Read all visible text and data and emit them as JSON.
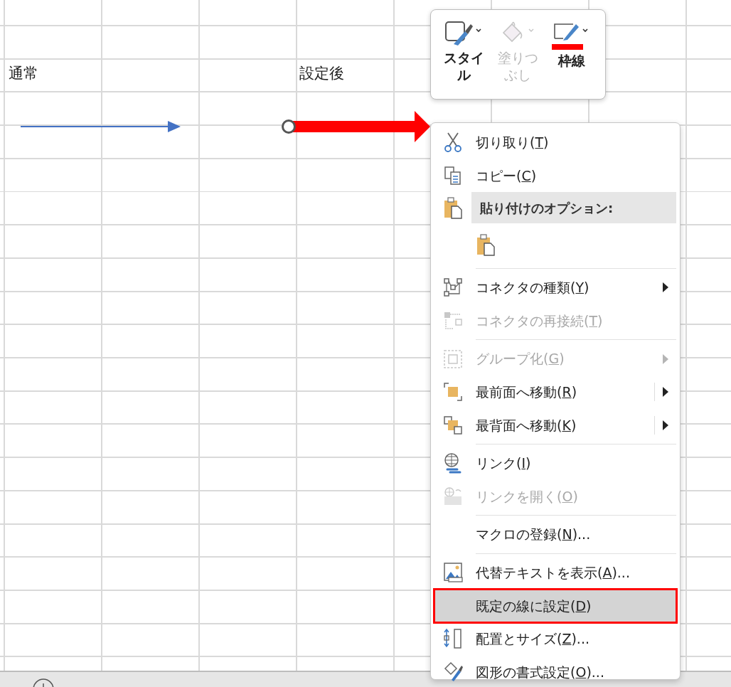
{
  "sheet": {
    "cells": [
      {
        "text": "通常"
      },
      {
        "text": "設定後"
      }
    ]
  },
  "mini_toolbar": {
    "buttons": [
      {
        "label": "スタイル",
        "disabled": false
      },
      {
        "label": "塗りつぶし",
        "disabled": true
      },
      {
        "label": "枠線",
        "disabled": false,
        "color": "#ff0000"
      }
    ]
  },
  "context_menu": {
    "items": [
      {
        "kind": "item",
        "text": "切り取り(",
        "key": "T",
        "after": ")",
        "disabled": false,
        "submenu": false,
        "split": false,
        "selected": false
      },
      {
        "kind": "item",
        "text": "コピー(",
        "key": "C",
        "after": ")",
        "disabled": false,
        "submenu": false,
        "split": false,
        "selected": false
      },
      {
        "kind": "header",
        "text": "貼り付けのオプション:"
      },
      {
        "kind": "paste"
      },
      {
        "kind": "separator"
      },
      {
        "kind": "item",
        "text": "コネクタの種類(",
        "key": "Y",
        "after": ")",
        "disabled": false,
        "submenu": true,
        "split": false,
        "selected": false
      },
      {
        "kind": "item",
        "text": "コネクタの再接続(",
        "key": "T",
        "after": ")",
        "disabled": true,
        "submenu": false,
        "split": false,
        "selected": false
      },
      {
        "kind": "separator"
      },
      {
        "kind": "item",
        "text": "グループ化(",
        "key": "G",
        "after": ")",
        "disabled": true,
        "submenu": true,
        "split": false,
        "selected": false
      },
      {
        "kind": "item",
        "text": "最前面へ移動(",
        "key": "R",
        "after": ")",
        "disabled": false,
        "submenu": true,
        "split": true,
        "selected": false
      },
      {
        "kind": "item",
        "text": "最背面へ移動(",
        "key": "K",
        "after": ")",
        "disabled": false,
        "submenu": true,
        "split": true,
        "selected": false
      },
      {
        "kind": "separator"
      },
      {
        "kind": "item",
        "text": "リンク(",
        "key": "I",
        "after": ")",
        "disabled": false,
        "submenu": false,
        "split": false,
        "selected": false
      },
      {
        "kind": "item",
        "text": "リンクを開く(",
        "key": "O",
        "after": ")",
        "disabled": true,
        "submenu": false,
        "split": false,
        "selected": false
      },
      {
        "kind": "separator"
      },
      {
        "kind": "item",
        "text": "マクロの登録(",
        "key": "N",
        "after": ")...",
        "disabled": false,
        "submenu": false,
        "split": false,
        "selected": false
      },
      {
        "kind": "separator"
      },
      {
        "kind": "item",
        "text": "代替テキストを表示(",
        "key": "A",
        "after": ")...",
        "disabled": false,
        "submenu": false,
        "split": false,
        "selected": false
      },
      {
        "kind": "item",
        "text": "既定の線に設定(",
        "key": "D",
        "after": ")",
        "disabled": false,
        "submenu": false,
        "split": false,
        "selected": true
      },
      {
        "kind": "item",
        "text": "配置とサイズ(",
        "key": "Z",
        "after": ")...",
        "disabled": false,
        "submenu": false,
        "split": false,
        "selected": false
      },
      {
        "kind": "item",
        "text": "図形の書式設定(",
        "key": "O",
        "after": ")...",
        "disabled": false,
        "submenu": false,
        "split": false,
        "selected": false
      }
    ]
  }
}
